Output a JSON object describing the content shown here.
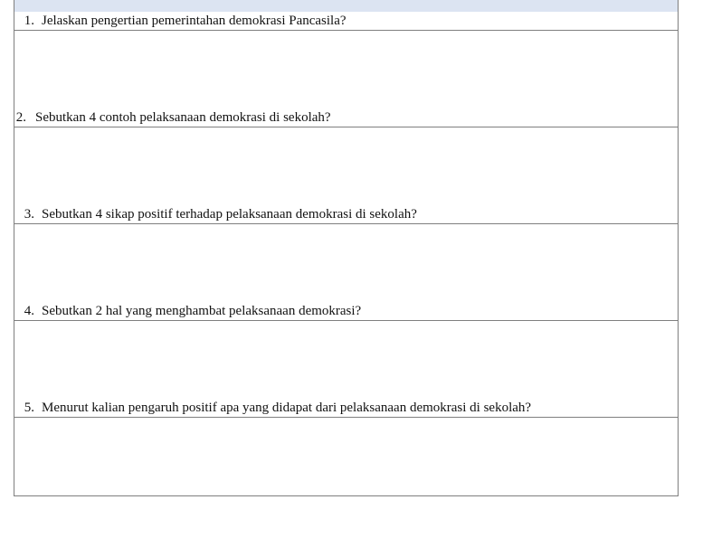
{
  "worksheet": {
    "questions": [
      {
        "number": "1.",
        "text": "Jelaskan pengertian pemerintahan demokrasi Pancasila?",
        "answer": ""
      },
      {
        "number": "2.",
        "text": "Sebutkan 4 contoh pelaksanaan demokrasi di sekolah?",
        "answer": ""
      },
      {
        "number": "3.",
        "text": "Sebutkan 4 sikap positif terhadap pelaksanaan demokrasi di sekolah?",
        "answer": ""
      },
      {
        "number": "4.",
        "text": "Sebutkan 2 hal yang menghambat pelaksanaan demokrasi?",
        "answer": ""
      },
      {
        "number": "5.",
        "text": "Menurut kalian pengaruh positif apa yang didapat dari pelaksanaan demokrasi di sekolah?",
        "answer": ""
      }
    ]
  }
}
